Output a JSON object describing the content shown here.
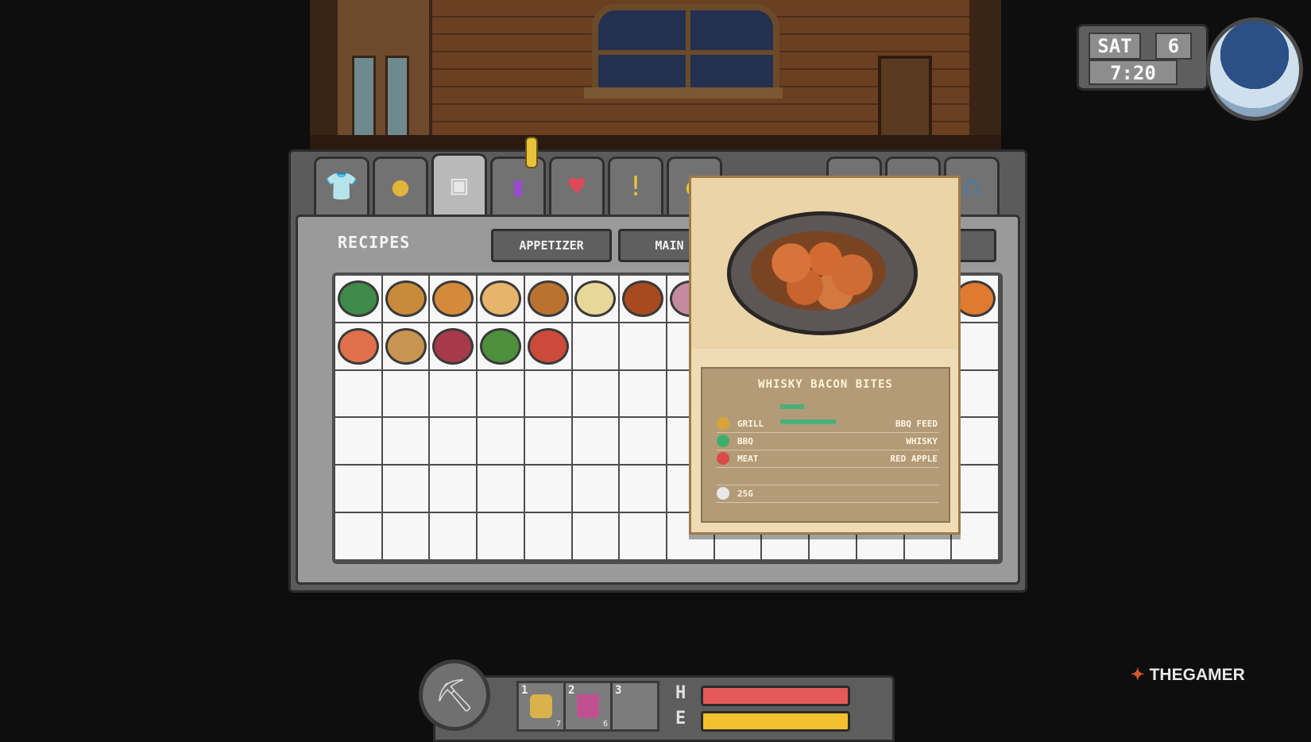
{
  "hud_clock": {
    "day": "SAT",
    "date": "6",
    "time": "7:20"
  },
  "menu": {
    "tabs": [
      {
        "icon": "shirt-icon",
        "glyph": "👕"
      },
      {
        "icon": "coin-icon",
        "glyph": "●"
      },
      {
        "icon": "recipe-scroll-icon",
        "glyph": "▣"
      },
      {
        "icon": "stats-bars-icon",
        "glyph": "▮"
      },
      {
        "icon": "heart-icon",
        "glyph": "♥"
      },
      {
        "icon": "alert-icon",
        "glyph": "!"
      },
      {
        "icon": "gold-icon",
        "glyph": "◐"
      },
      {
        "icon": "bell-icon",
        "glyph": "◆"
      },
      {
        "icon": "quill-icon",
        "glyph": "/"
      },
      {
        "icon": "door-icon",
        "glyph": "∩"
      }
    ]
  },
  "recipes": {
    "title": "RECIPES",
    "categories": [
      "APPETIZER",
      "MAIN CO"
    ],
    "items": [
      {
        "name": "greens-salad",
        "color": "#3f8a4a"
      },
      {
        "name": "pudding",
        "color": "#c98a3a"
      },
      {
        "name": "fried-chicken",
        "color": "#d48a3a"
      },
      {
        "name": "dumpling",
        "color": "#e6b46a"
      },
      {
        "name": "toast",
        "color": "#b9732f"
      },
      {
        "name": "sushi-roll",
        "color": "#e7d89a"
      },
      {
        "name": "whisky-bacon-bites",
        "color": "#a84a20"
      },
      {
        "name": "skewers",
        "color": "#c48aa0"
      },
      {
        "name": "fries",
        "color": "#e07a30"
      },
      {
        "name": "shrimp-cocktail",
        "color": "#e0704a"
      },
      {
        "name": "noodle-plate",
        "color": "#c89550"
      },
      {
        "name": "berry-plate",
        "color": "#a63a4a"
      },
      {
        "name": "veggie-tray",
        "color": "#4d8f3a"
      },
      {
        "name": "meatball-plate",
        "color": "#cc4a3a"
      }
    ]
  },
  "detail": {
    "dish_name": "WHISKY BACON BITES",
    "rows": [
      {
        "key": "GRILL",
        "value": "BBQ FEED",
        "icon": "grill-icon",
        "color": "#d9a33a"
      },
      {
        "key": "BBQ",
        "value": "WHISKY",
        "icon": "flask-icon",
        "color": "#3fae6a"
      },
      {
        "key": "MEAT",
        "value": "RED APPLE",
        "icon": "meat-icon",
        "color": "#d84a4a"
      },
      {
        "key": "",
        "value": "",
        "icon": "",
        "color": ""
      },
      {
        "key": "25G",
        "value": "",
        "icon": "coin-icon",
        "color": "#e8e8e8"
      }
    ]
  },
  "hotbar": {
    "tool_icon": "pickaxe-icon",
    "slots": [
      {
        "num": "1",
        "qty": "7",
        "item": "chips-icon",
        "color": "#d9b24a"
      },
      {
        "num": "2",
        "qty": "6",
        "item": "mug-icon",
        "color": "#c05090"
      },
      {
        "num": "3",
        "qty": "",
        "item": "",
        "color": ""
      }
    ],
    "health_label": "H",
    "energy_label": "E",
    "health_fill": 1.0,
    "energy_fill": 1.0,
    "health_color": "#e45a5a",
    "energy_color": "#f2c12e"
  },
  "watermark": {
    "text": "THEGAMER"
  }
}
